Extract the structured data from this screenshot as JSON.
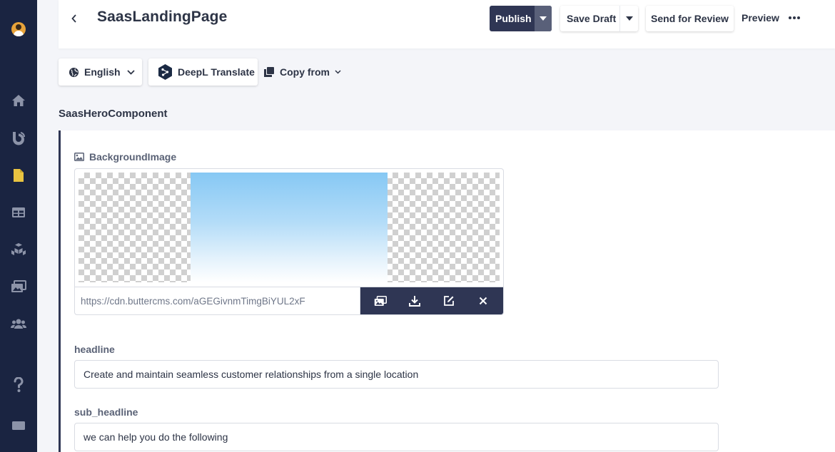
{
  "sidebar": {
    "items": [
      {
        "name": "home",
        "icon": "home-icon"
      },
      {
        "name": "blog",
        "icon": "blog-icon"
      },
      {
        "name": "pages",
        "icon": "pages-icon"
      },
      {
        "name": "collections",
        "icon": "collections-icon"
      },
      {
        "name": "components",
        "icon": "components-icon"
      },
      {
        "name": "media",
        "icon": "media-icon"
      },
      {
        "name": "users",
        "icon": "users-icon"
      },
      {
        "name": "help",
        "icon": "help-icon"
      },
      {
        "name": "chat",
        "icon": "chat-icon"
      }
    ],
    "active_color": "#e8c341"
  },
  "header": {
    "title": "SaasLandingPage",
    "publish_label": "Publish",
    "save_draft_label": "Save Draft",
    "send_review_label": "Send for Review",
    "preview_label": "Preview"
  },
  "toolbar": {
    "language": "English",
    "deepl_label": "DeepL Translate",
    "copy_from_label": "Copy from"
  },
  "component": {
    "title": "SaasHeroComponent",
    "background_image": {
      "label": "BackgroundImage",
      "url": "https://cdn.buttercms.com/aGEGivnmTimgBiYUL2xF"
    },
    "headline": {
      "label": "headline",
      "value": "Create and maintain seamless customer relationships from a single location"
    },
    "sub_headline": {
      "label": "sub_headline",
      "value": "we can help you do the following"
    }
  },
  "colors": {
    "sidebar_bg": "#1a2441",
    "primary_button": "#2f3654",
    "page_bg": "#f4f5f9"
  }
}
